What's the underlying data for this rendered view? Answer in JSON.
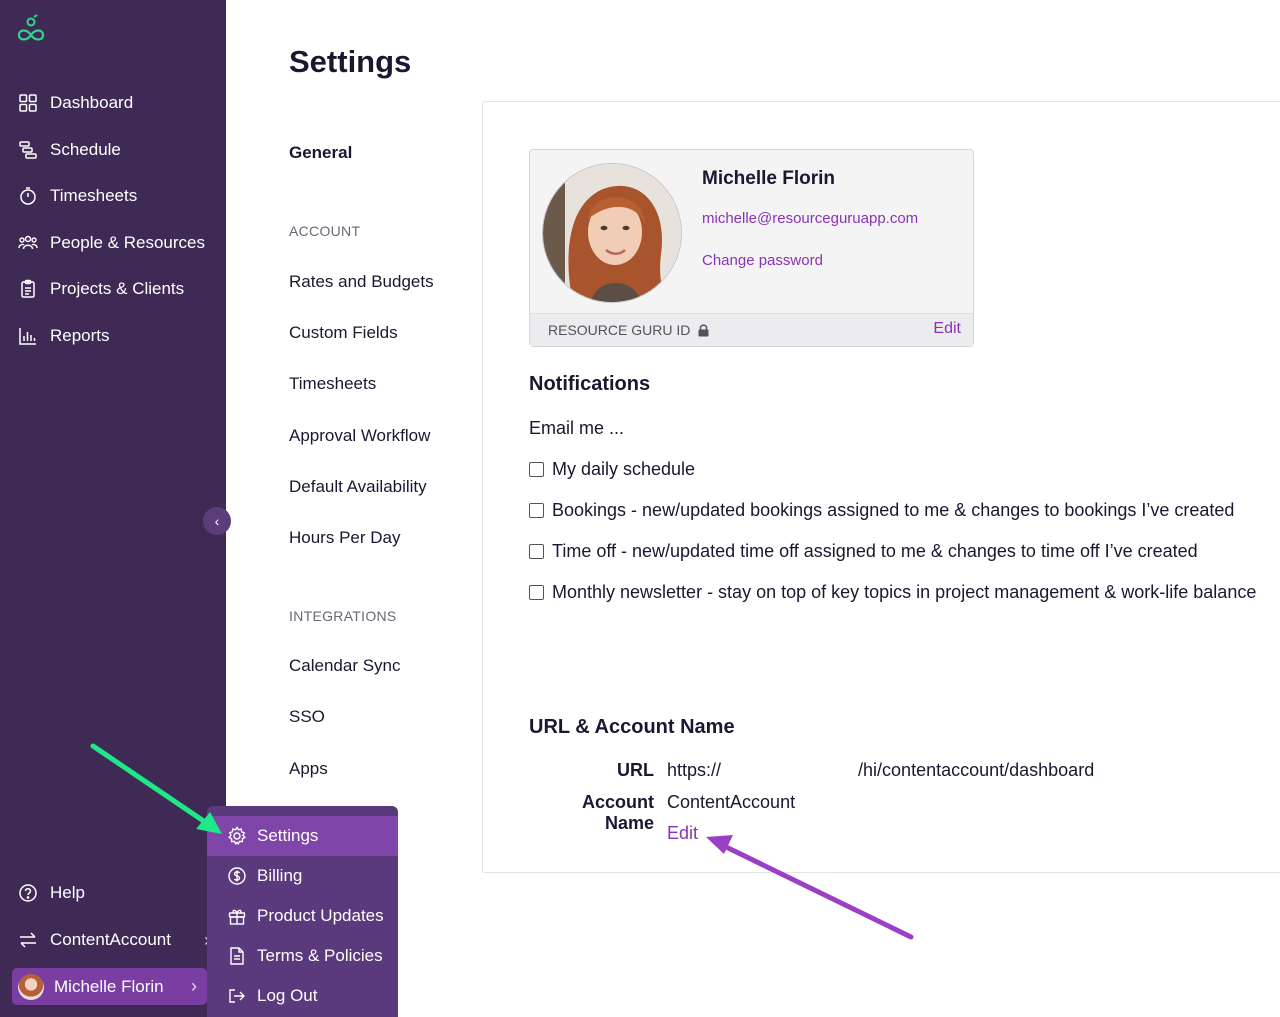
{
  "sidebar": {
    "items": [
      {
        "label": "Dashboard",
        "icon": "dashboard-icon"
      },
      {
        "label": "Schedule",
        "icon": "schedule-icon"
      },
      {
        "label": "Timesheets",
        "icon": "stopwatch-icon"
      },
      {
        "label": "People & Resources",
        "icon": "people-icon"
      },
      {
        "label": "Projects & Clients",
        "icon": "clipboard-icon"
      },
      {
        "label": "Reports",
        "icon": "bar-chart-icon"
      }
    ],
    "help_label": "Help",
    "account_label": "ContentAccount",
    "user_label": "Michelle Florin",
    "collapse_icon": "chevron-left-icon"
  },
  "popup_menu": {
    "items": [
      {
        "label": "Settings",
        "icon": "gear-icon"
      },
      {
        "label": "Billing",
        "icon": "dollar-icon"
      },
      {
        "label": "Product Updates",
        "icon": "gift-icon"
      },
      {
        "label": "Terms & Policies",
        "icon": "document-icon"
      },
      {
        "label": "Log Out",
        "icon": "logout-icon"
      }
    ]
  },
  "page": {
    "title": "Settings"
  },
  "subnav": {
    "general": "General",
    "account_heading": "ACCOUNT",
    "account_items": [
      "Rates and Budgets",
      "Custom Fields",
      "Timesheets",
      "Approval Workflow",
      "Default Availability",
      "Hours Per Day"
    ],
    "integrations_heading": "INTEGRATIONS",
    "integration_items": [
      "Calendar Sync",
      "SSO",
      "Apps"
    ]
  },
  "profile": {
    "name": "Michelle Florin",
    "email": "michelle@resourceguruapp.com",
    "change_password": "Change password",
    "id_label": "RESOURCE GURU ID",
    "edit": "Edit"
  },
  "notifications": {
    "title": "Notifications",
    "email_me": "Email me ...",
    "options": [
      "My daily schedule",
      "Bookings - new/updated bookings assigned to me & changes to bookings I’ve created",
      "Time off - new/updated time off assigned to me & changes to time off I’ve created",
      "Monthly newsletter - stay on top of key topics in project management & work-life balance"
    ]
  },
  "url_section": {
    "title": "URL & Account Name",
    "url_label": "URL",
    "url_prefix": "https://",
    "url_suffix": "/hi/contentaccount/dashboard",
    "account_name_label": "Account Name",
    "account_name_value": "ContentAccount",
    "edit": "Edit"
  },
  "colors": {
    "sidebar_bg": "#3f2a56",
    "accent": "#8a33b5",
    "highlight_arrow": "#1ee888",
    "annotation_arrow": "#9b3fc4"
  }
}
